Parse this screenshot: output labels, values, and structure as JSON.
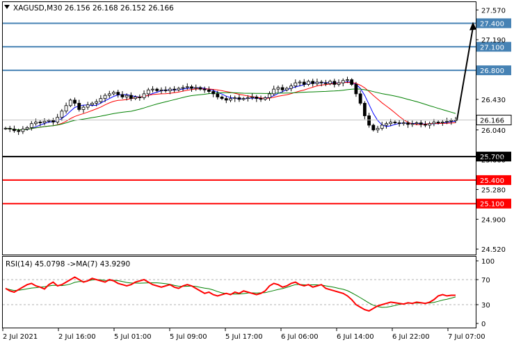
{
  "chart_data": [
    {
      "type": "candlestick",
      "symbol": "XAGUSD,M30",
      "ohlc": [
        "26.156",
        "26.168",
        "26.152",
        "26.166"
      ],
      "ylim": [
        24.45,
        27.67
      ],
      "y_ticks": [
        "27.570",
        "27.190",
        "26.430",
        "26.040",
        "25.660",
        "25.280",
        "24.900",
        "24.520"
      ],
      "x_ticks": [
        "2 Jul 2021",
        "2 Jul 16:00",
        "5 Jul 01:00",
        "5 Jul 09:00",
        "5 Jul 17:00",
        "6 Jul 06:00",
        "6 Jul 14:00",
        "6 Jul 22:00",
        "7 Jul 07:00"
      ],
      "current_price": "26.166",
      "levels": [
        {
          "value": 27.4,
          "label": "27.400",
          "color": "#4682b4"
        },
        {
          "value": 27.1,
          "label": "27.100",
          "color": "#4682b4"
        },
        {
          "value": 26.8,
          "label": "26.800",
          "color": "#4682b4"
        },
        {
          "value": 25.7,
          "label": "25.700",
          "color": "#000000"
        },
        {
          "value": 25.4,
          "label": "25.400",
          "color": "#ff0000"
        },
        {
          "value": 25.1,
          "label": "25.100",
          "color": "#ff0000"
        }
      ],
      "forecast_arrow": {
        "from": 26.166,
        "to": 27.4
      },
      "closes": [
        26.06,
        26.05,
        26.03,
        26.02,
        26.05,
        26.07,
        26.12,
        26.14,
        26.13,
        26.15,
        26.16,
        26.14,
        26.2,
        26.28,
        26.35,
        26.42,
        26.38,
        26.3,
        26.33,
        26.36,
        26.38,
        26.4,
        26.44,
        26.48,
        26.5,
        26.52,
        26.49,
        26.46,
        26.48,
        26.44,
        26.46,
        26.45,
        26.5,
        26.55,
        26.56,
        26.54,
        26.55,
        26.54,
        26.56,
        26.55,
        26.57,
        26.58,
        26.59,
        26.57,
        26.58,
        26.56,
        26.55,
        26.53,
        26.5,
        26.46,
        26.44,
        26.42,
        26.44,
        26.45,
        26.43,
        26.44,
        26.45,
        26.46,
        26.44,
        26.43,
        26.45,
        26.5,
        26.56,
        26.58,
        26.55,
        26.57,
        26.6,
        26.64,
        26.65,
        26.62,
        26.66,
        26.63,
        26.65,
        26.64,
        26.63,
        26.66,
        26.62,
        26.64,
        26.67,
        26.68,
        26.62,
        26.5,
        26.38,
        26.22,
        26.1,
        26.04,
        26.06,
        26.1,
        26.12,
        26.14,
        26.13,
        26.12,
        26.13,
        26.11,
        26.12,
        26.13,
        26.11,
        26.1,
        26.12,
        26.14,
        26.13,
        26.14,
        26.15,
        26.16,
        26.166
      ],
      "ma_fast_color": "#0000ff",
      "ma_mid_color": "#ff0000",
      "ma_slow_color": "#008000"
    },
    {
      "type": "line",
      "indicator": "RSI(14) 45.0798  ->MA(7) 43.9290",
      "ylim": [
        0,
        100
      ],
      "y_ticks": [
        "100",
        "70",
        "30",
        "0"
      ],
      "levels": [
        70,
        30
      ],
      "rsi": [
        56,
        52,
        50,
        54,
        58,
        62,
        64,
        60,
        58,
        55,
        62,
        66,
        60,
        62,
        66,
        70,
        74,
        70,
        66,
        68,
        72,
        70,
        68,
        66,
        70,
        68,
        64,
        62,
        60,
        62,
        66,
        68,
        70,
        66,
        62,
        60,
        58,
        60,
        62,
        58,
        56,
        60,
        62,
        60,
        56,
        52,
        48,
        50,
        46,
        44,
        46,
        48,
        46,
        50,
        48,
        52,
        50,
        48,
        46,
        48,
        52,
        60,
        64,
        62,
        58,
        60,
        64,
        66,
        62,
        60,
        62,
        58,
        60,
        62,
        56,
        54,
        52,
        50,
        48,
        44,
        38,
        30,
        26,
        22,
        20,
        24,
        28,
        30,
        32,
        34,
        33,
        32,
        31,
        33,
        32,
        34,
        33,
        32,
        34,
        38,
        44,
        46,
        44,
        45,
        45
      ],
      "rsi_color": "#ff0000",
      "ma_color": "#008000"
    }
  ]
}
